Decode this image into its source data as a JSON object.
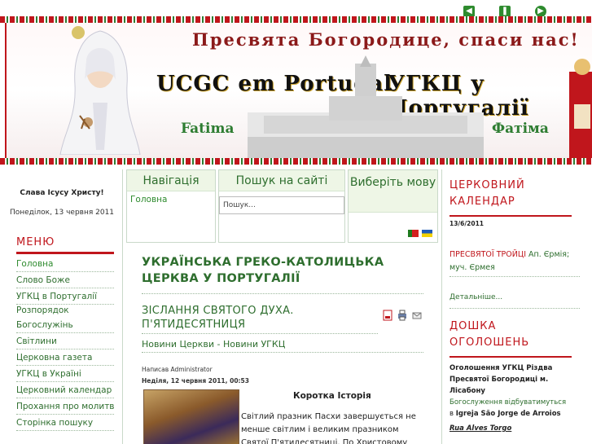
{
  "header": {
    "title_ua": "Пресвята Богородице, спаси нас!",
    "left_title": "UCGC em Portugal",
    "right_title": "УГКЦ у Португалії",
    "fatima_left": "Fatima",
    "fatima_right": "Фатіма",
    "top_icons": [
      "rewind-icon",
      "pause-icon",
      "forward-icon"
    ]
  },
  "sidebar": {
    "greeting": "Слава Ісусу Христу!",
    "date": "Понеділок, 13 червня 2011",
    "menu_title": "МЕНЮ",
    "items": [
      {
        "label": "Головна"
      },
      {
        "label": "Слово Боже"
      },
      {
        "label": "УГКЦ в Португалії"
      },
      {
        "label": "Розпорядок"
      },
      {
        "label": "Богослужінь"
      },
      {
        "label": "Світлини"
      },
      {
        "label": "Церковна газета"
      },
      {
        "label": "УГКЦ в Україні"
      },
      {
        "label": "Церковний календар"
      },
      {
        "label": "Прохання про молитву"
      },
      {
        "label": "Сторінка пошуку"
      }
    ]
  },
  "modules": {
    "nav_title": "Навігація",
    "nav_link": "Головна",
    "search_title": "Пошук на сайті",
    "search_placeholder": "Пошук...",
    "lang_title": "Виберіть мову"
  },
  "article": {
    "site_title": "УКРАЇНСЬКА ГРЕКО-КАТОЛИЦЬКА ЦЕРКВА У ПОРТУГАЛІЇ",
    "title": "ЗІСЛАННЯ СВЯТОГО ДУХА. П'ЯТИДЕСЯТНИЦЯ",
    "category": "Новини Церкви - Новини УГКЦ",
    "author": "Написав Administrator",
    "date": "Неділя, 12 червня 2011, 00:53",
    "subheading": "Коротка Історія",
    "body": "Світлий празник Пасхи завершується не менше світлим і великим празником Святої П'ятидесятниці. По Христовому"
  },
  "calendar": {
    "title": "ЦЕРКОВНИЙ КАЛЕНДАР",
    "date": "13/6/2011",
    "feast_highlight": "ПРЕСВЯТОЇ ТРОЙЦІ",
    "feast_rest": " Ап. Єрмія; муч. Єрмея",
    "more": "Детальніше..."
  },
  "board": {
    "title": "ДОШКА ОГОЛОШЕНЬ",
    "line1": "Оголошення УГКЦ Різдва Пресвятої Богородиці м. Лісабону",
    "line2": "Богослуження відбуватимуться",
    "line3_prefix": "в ",
    "line3_bold": "Igreja São Jorge de Arroios",
    "street": "Rua Alves Torgo"
  },
  "colors": {
    "accent_red": "#c0161c",
    "accent_green": "#2e6e2e"
  }
}
